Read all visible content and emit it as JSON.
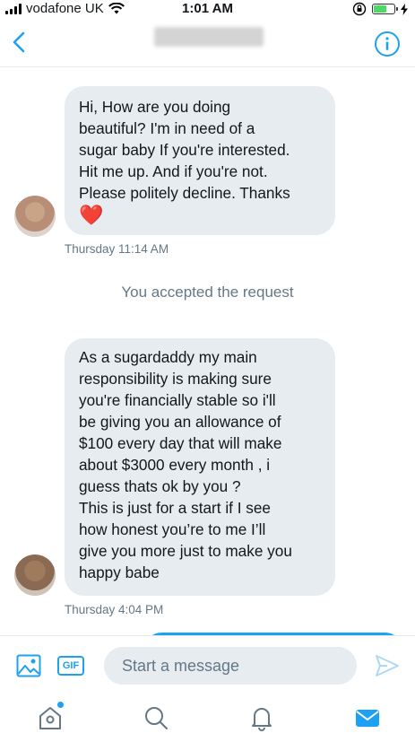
{
  "status_bar": {
    "carrier": "vodafone UK",
    "time": "1:01 AM"
  },
  "header": {
    "title": "",
    "back_icon": "chevron-left-icon",
    "info_icon": "info-icon"
  },
  "conversation": {
    "messages": [
      {
        "text": "Hi, How are you doing\nbeautiful? I'm in need of a\nsugar baby If you're interested.\nHit me up. And if you're not.\nPlease politely decline. Thanks",
        "emoji": "❤️",
        "timestamp": "Thursday 11:14 AM"
      },
      {
        "text": "As a sugardaddy  my main\nresponsibility is making sure\nyou're financially stable so i'll\nbe giving you an allowance of\n$100 every day that will make\nabout $3000 every month , i\nguess thats ok by you ?\nThis is just for a start if I see\nhow honest you’re to me I’ll\ngive you more just to make you\nhappy babe",
        "timestamp": "Thursday 4:04 PM"
      }
    ],
    "system_message": "You accepted the request"
  },
  "composer": {
    "gif_label": "GIF",
    "placeholder": "Start a message"
  },
  "tab_bar": {
    "items": [
      "home-icon",
      "search-icon",
      "notifications-icon",
      "messages-icon"
    ]
  },
  "colors": {
    "accent": "#1da1f2",
    "bubble": "#e6ecf0",
    "secondary_text": "#657786"
  }
}
